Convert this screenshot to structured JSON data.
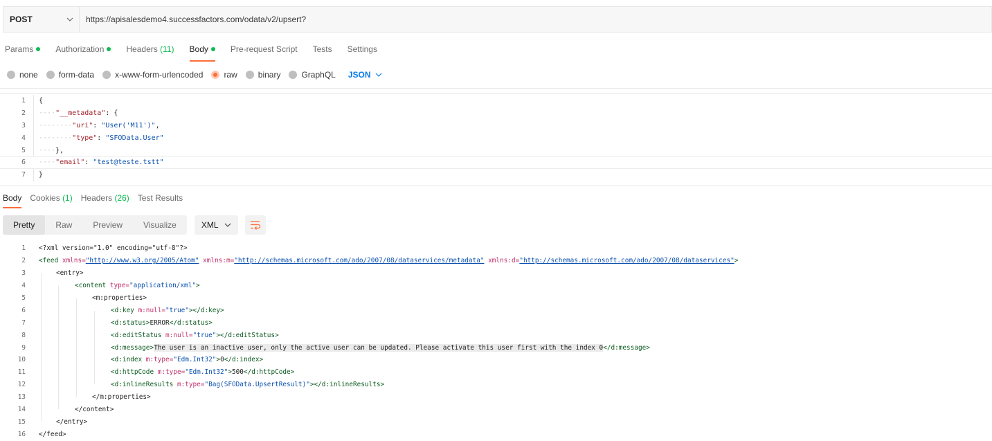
{
  "request": {
    "method": "POST",
    "url": "https://apisalesdemo4.successfactors.com/odata/v2/upsert?"
  },
  "req_tabs": {
    "params": "Params",
    "authorization": "Authorization",
    "headers": "Headers",
    "headers_count": "(11)",
    "body": "Body",
    "prerequest": "Pre-request Script",
    "tests": "Tests",
    "settings": "Settings"
  },
  "body_types": {
    "none": "none",
    "form_data": "form-data",
    "urlencoded": "x-www-form-urlencoded",
    "raw": "raw",
    "binary": "binary",
    "graphql": "GraphQL",
    "language": "JSON",
    "selected": "raw"
  },
  "request_body": {
    "line_numbers": [
      "1",
      "2",
      "3",
      "4",
      "5",
      "6",
      "7"
    ],
    "l1": "{",
    "l2_key": "\"__metadata\"",
    "l2_rest": ": {",
    "l3_key": "\"uri\"",
    "l3_val": "\"User('M11')\"",
    "l4_key": "\"type\"",
    "l4_val": "\"SFOData.User\"",
    "l5": "},",
    "l6_key": "\"email\"",
    "l6_val": "\"test@teste.tstt\"",
    "l7": "}"
  },
  "resp_tabs": {
    "body": "Body",
    "cookies": "Cookies",
    "cookies_count": "(1)",
    "headers": "Headers",
    "headers_count": "(26)",
    "test_results": "Test Results"
  },
  "view": {
    "pretty": "Pretty",
    "raw": "Raw",
    "preview": "Preview",
    "visualize": "Visualize",
    "format": "XML",
    "wrap_icon": "wrap-lines-icon"
  },
  "response_body": {
    "line_numbers": [
      "1",
      "2",
      "3",
      "4",
      "5",
      "6",
      "7",
      "8",
      "9",
      "10",
      "11",
      "12",
      "13",
      "14",
      "15",
      "16"
    ],
    "l1": "<?xml version=\"1.0\" encoding=\"utf-8\"?>",
    "l2_feed_open": "<feed",
    "l2_attr1": " xmlns=",
    "l2_url1": "\"http://www.w3.org/2005/Atom\"",
    "l2_attr2": " xmlns:m=",
    "l2_url2": "\"http://schemas.microsoft.com/ado/2007/08/dataservices/metadata\"",
    "l2_attr3": " xmlns:d=",
    "l2_url3": "\"http://schemas.microsoft.com/ado/2007/08/dataservices\"",
    "l2_close": ">",
    "l3": "<entry>",
    "l4_open": "<content",
    "l4_attr": " type=",
    "l4_val": "\"application/xml\"",
    "l4_close": ">",
    "l5": "<m:properties>",
    "l6_open": "<d:key",
    "l6_attr": " m:null=",
    "l6_val": "\"true\"",
    "l6_close": "></d:key>",
    "l7_open": "<d:status>",
    "l7_text": "ERROR",
    "l7_close": "</d:status>",
    "l8_open": "<d:editStatus",
    "l8_attr": " m:null=",
    "l8_val": "\"true\"",
    "l8_close": "></d:editStatus>",
    "l9_open": "<d:message>",
    "l9_text": "The user is an inactive user, only the active user can be updated. Please activate this user first with the index 0",
    "l9_close": "</d:message>",
    "l10_open": "<d:index",
    "l10_attr": " m:type=",
    "l10_val": "\"Edm.Int32\"",
    "l10_gt": ">",
    "l10_text": "0",
    "l10_close": "</d:index>",
    "l11_open": "<d:httpCode",
    "l11_attr": " m:type=",
    "l11_val": "\"Edm.Int32\"",
    "l11_gt": ">",
    "l11_text": "500",
    "l11_close": "</d:httpCode>",
    "l12_open": "<d:inlineResults",
    "l12_attr": " m:type=",
    "l12_val": "\"Bag(SFOData.UpsertResult)\"",
    "l12_close": "></d:inlineResults>",
    "l13": "</m:properties>",
    "l14": "</content>",
    "l15": "</entry>",
    "l16": "</feed>"
  },
  "colors": {
    "accent": "#ff6c37",
    "status_green": "#0cbb52",
    "link_blue": "#097bed"
  }
}
